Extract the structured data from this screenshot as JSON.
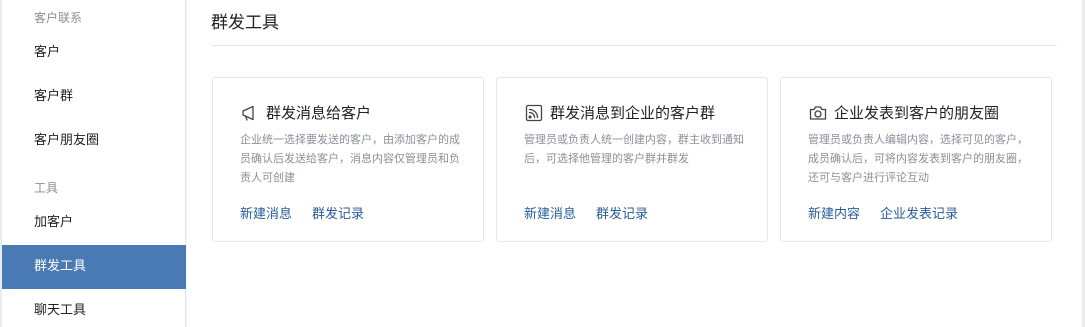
{
  "sidebar": {
    "sections": [
      {
        "label": "客户联系"
      },
      {
        "label": "工具"
      }
    ],
    "items": [
      {
        "label": "客户"
      },
      {
        "label": "客户群"
      },
      {
        "label": "客户朋友圈"
      },
      {
        "label": "加客户"
      },
      {
        "label": "群发工具"
      },
      {
        "label": "聊天工具"
      }
    ],
    "active_color": "#4a7ab4"
  },
  "main": {
    "title": "群发工具",
    "cards": [
      {
        "icon": "megaphone-icon",
        "title": "群发消息给客户",
        "description": "企业统一选择要发送的客户，由添加客户的成员确认后发送给客户，消息内容仅管理员和负责人可创建",
        "links": [
          "新建消息",
          "群发记录"
        ]
      },
      {
        "icon": "broadcast-icon",
        "title": "群发消息到企业的客户群",
        "description": "管理员或负责人统一创建内容，群主收到通知后，可选择他管理的客户群并群发",
        "links": [
          "新建消息",
          "群发记录"
        ]
      },
      {
        "icon": "camera-icon",
        "title": "企业发表到客户的朋友圈",
        "description": "管理员或负责人编辑内容，选择可见的客户，成员确认后，可将内容发表到客户的朋友圈，还可与客户进行评论互动",
        "links": [
          "新建内容",
          "企业发表记录"
        ]
      }
    ],
    "link_color": "#2a5c99"
  }
}
